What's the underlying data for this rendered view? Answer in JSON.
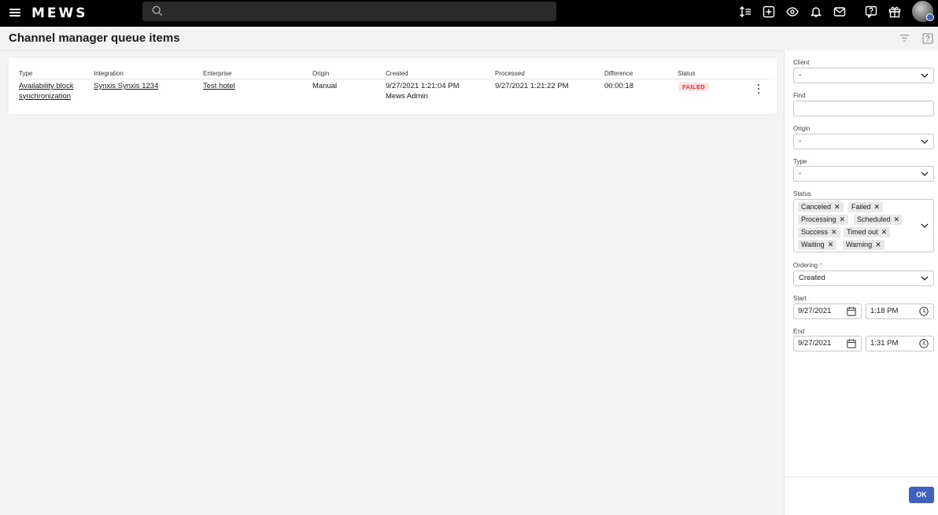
{
  "app": {
    "logo": "MEWS"
  },
  "page": {
    "title": "Channel manager queue items"
  },
  "table": {
    "headers": {
      "type": "Type",
      "integration": "Integration",
      "enterprise": "Enterprise",
      "origin": "Origin",
      "created": "Created",
      "processed": "Processed",
      "difference": "Difference",
      "status": "Status"
    },
    "rows": [
      {
        "type_line1": "Availability block",
        "type_line2": "synchronization",
        "integration": "Synxis Synxis 1234",
        "enterprise": "Test hotel",
        "origin": "Manual",
        "created": "9/27/2021 1:21:04 PM",
        "created_by": "Mews Admin",
        "processed": "9/27/2021 1:21:22 PM",
        "difference": "00:00:18",
        "status": "FAILED"
      }
    ]
  },
  "filters": {
    "client": {
      "label": "Client",
      "value": "-"
    },
    "find": {
      "label": "Find",
      "value": ""
    },
    "origin": {
      "label": "Origin",
      "value": "-"
    },
    "type": {
      "label": "Type",
      "value": "-"
    },
    "status": {
      "label": "Status",
      "chips": [
        "Canceled",
        "Failed",
        "Processing",
        "Scheduled",
        "Success",
        "Timed out",
        "Waiting",
        "Warning"
      ]
    },
    "ordering": {
      "label": "Ordering",
      "required_mark": "*",
      "value": "Created"
    },
    "start": {
      "label": "Start",
      "date": "9/27/2021",
      "time": "1:18 PM"
    },
    "end": {
      "label": "End",
      "date": "9/27/2021",
      "time": "1:31 PM"
    },
    "ok_label": "OK"
  },
  "colors": {
    "accent": "#3e62bd",
    "failed_text": "#d63c3c",
    "failed_bg": "#fde3e3",
    "topbar": "#000000"
  }
}
